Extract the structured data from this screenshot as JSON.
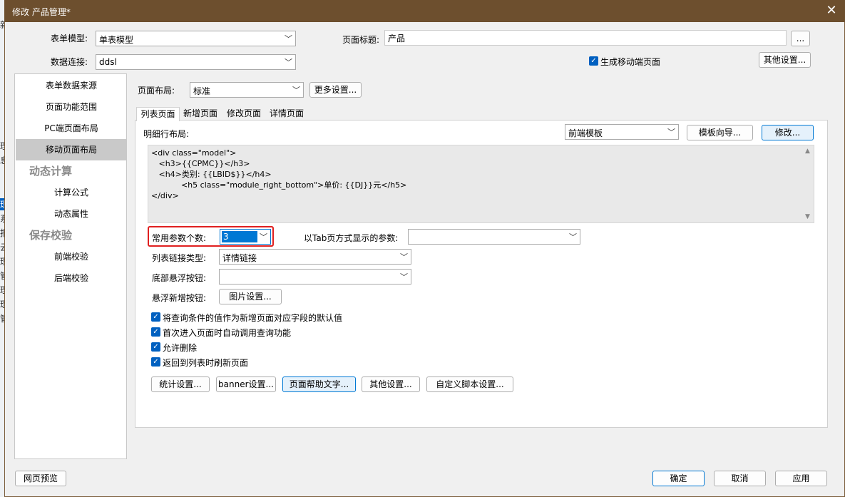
{
  "background_fragments": [
    "新",
    "理",
    "息",
    "理",
    "系",
    "报",
    "云",
    "理",
    "管",
    "理",
    "理",
    "管"
  ],
  "window": {
    "title": "修改 产品管理*",
    "close_glyph": "✕"
  },
  "top": {
    "form_model_label": "表单模型:",
    "form_model_value": "单表模型",
    "page_title_label": "页面标题:",
    "page_title_value": "产品",
    "ellipsis_label": "...",
    "data_conn_label": "数据连接:",
    "data_conn_value": "ddsl",
    "mobile_label": "生成移动端页面",
    "other_settings_label": "其他设置..."
  },
  "sidebar": {
    "items": [
      {
        "label": "表单数据来源"
      },
      {
        "label": "页面功能范围"
      },
      {
        "label": "PC端页面布局"
      },
      {
        "label": "移动页面布局"
      }
    ],
    "section_calc": "动态计算",
    "calc_items": [
      {
        "label": "计算公式"
      },
      {
        "label": "动态属性"
      }
    ],
    "section_save": "保存校验",
    "save_items": [
      {
        "label": "前端校验"
      },
      {
        "label": "后端校验"
      }
    ]
  },
  "layout": {
    "label": "页面布局:",
    "value": "标准",
    "more_label": "更多设置..."
  },
  "tabs": [
    {
      "label": "列表页面"
    },
    {
      "label": "新增页面"
    },
    {
      "label": "修改页面"
    },
    {
      "label": "详情页面"
    }
  ],
  "detail": {
    "label": "明细行布局:",
    "template_value": "前端模板",
    "wizard_label": "模板向导...",
    "edit_label": "修改...",
    "code": "<div class=\"model\">\n   <h3>{{CPMC}}</h3>\n   <h4>类别: {{LBID$}}</h4>\n            <h5 class=\"module_right_bottom\">单价: {{DJ}}元</h5>\n</div>"
  },
  "params": {
    "count_label": "常用参数个数:",
    "count_value": "3",
    "tab_label": "以Tab页方式显示的参数:",
    "tab_value": "",
    "link_type_label": "列表链接类型:",
    "link_type_value": "详情链接",
    "bottom_btn_label": "底部悬浮按钮:",
    "bottom_btn_value": "",
    "float_add_label": "悬浮新增按钮:",
    "image_settings_label": "图片设置..."
  },
  "checkboxes": [
    {
      "label": "将查询条件的值作为新增页面对应字段的默认值",
      "checked": true
    },
    {
      "label": "首次进入页面时自动调用查询功能",
      "checked": true
    },
    {
      "label": "允许删除",
      "checked": true
    },
    {
      "label": "返回到列表时刷新页面",
      "checked": true
    }
  ],
  "bottom_buttons": [
    {
      "label": "统计设置..."
    },
    {
      "label": "banner设置..."
    },
    {
      "label": "页面帮助文字..."
    },
    {
      "label": "其他设置..."
    },
    {
      "label": "自定义脚本设置..."
    }
  ],
  "footer": {
    "preview_label": "网页预览",
    "ok_label": "确定",
    "cancel_label": "取消",
    "apply_label": "应用"
  },
  "colors": {
    "titlebar": "#6d4f2e",
    "accent": "#0078d4",
    "highlight": "#e02020"
  }
}
